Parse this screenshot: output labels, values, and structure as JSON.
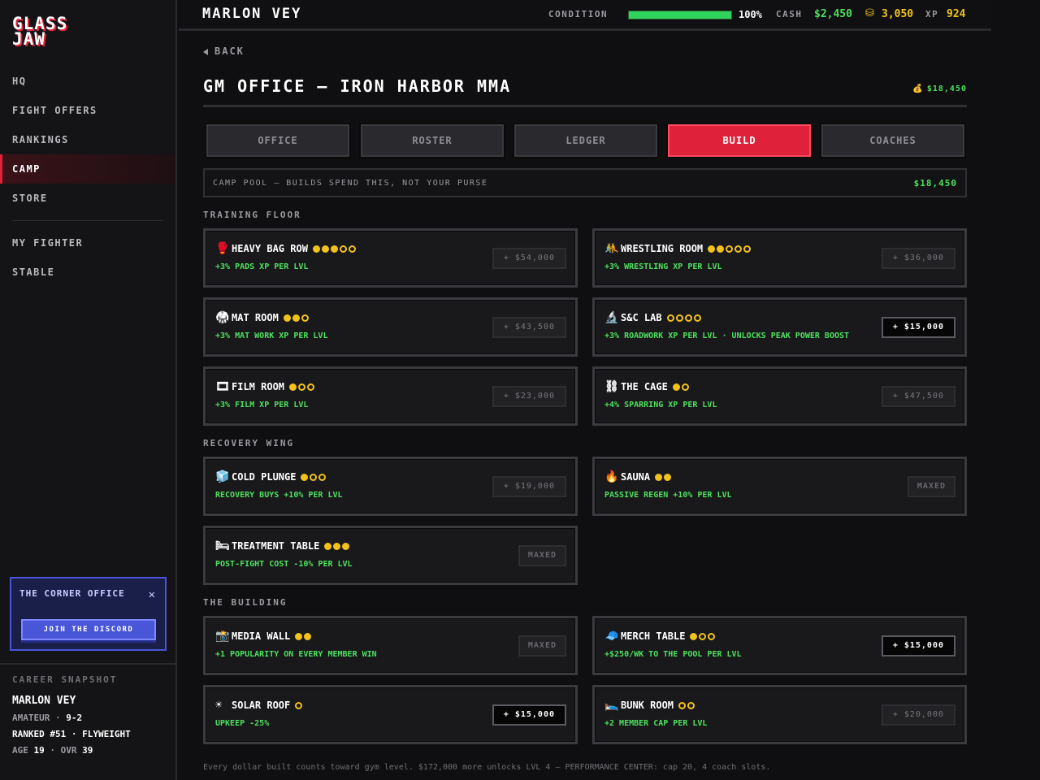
{
  "sidebar": {
    "logo_line1": "GLASS",
    "logo_line2": "JAW",
    "nav": [
      "HQ",
      "FIGHT OFFERS",
      "RANKINGS",
      "CAMP",
      "STORE"
    ],
    "nav_secondary": [
      "MY FIGHTER",
      "STABLE"
    ],
    "active": "CAMP",
    "discord": {
      "title": "THE CORNER OFFICE",
      "close": "✕",
      "button": "JOIN THE DISCORD"
    },
    "snapshot": {
      "heading": "CAREER SNAPSHOT",
      "name": "MARLON VEY",
      "level": "AMATEUR",
      "record": "9-2",
      "rank": "RANKED #51",
      "division": "FLYWEIGHT",
      "age_label": "AGE",
      "age": "19",
      "ovr_label": "OVR",
      "ovr": "39"
    }
  },
  "topbar": {
    "player": "MARLON VEY",
    "condition_label": "CONDITION",
    "condition_pct": 100,
    "condition_text": "100%",
    "cash_label": "CASH",
    "cash": "$2,450",
    "coins_icon": "coin-stack-icon",
    "coins": "3,050",
    "xp_label": "XP",
    "xp": "924",
    "colors": {
      "green": "#4de05e",
      "gold": "#f2c21b",
      "red": "#e0213a"
    }
  },
  "main": {
    "back": "BACK",
    "title": "GM OFFICE — IRON HARBOR MMA",
    "purse": "$18,450",
    "tabs": [
      "OFFICE",
      "ROSTER",
      "LEDGER",
      "BUILD",
      "COACHES"
    ],
    "active_tab": "BUILD",
    "pool_label": "CAMP POOL — BUILDS SPEND THIS, NOT YOUR PURSE",
    "pool_value": "$18,450",
    "sections": {
      "training": "TRAINING FLOOR",
      "recovery": "RECOVERY WING",
      "building": "THE BUILDING"
    },
    "cards": [
      {
        "icon": "boxing-glove-icon",
        "glyph": "🥊",
        "name": "HEAVY BAG ROW",
        "level": 3,
        "max": 5,
        "desc": "+3% PADS XP PER LVL",
        "button": "+ $54,000",
        "state": "locked"
      },
      {
        "icon": "wrestlers-icon",
        "glyph": "🤼",
        "name": "WRESTLING ROOM",
        "level": 2,
        "max": 5,
        "desc": "+3% WRESTLING XP PER LVL",
        "button": "+ $36,000",
        "state": "locked"
      },
      {
        "icon": "gi-icon",
        "glyph": "🥋",
        "name": "MAT ROOM",
        "level": 2,
        "max": 3,
        "desc": "+3% MAT WORK XP PER LVL",
        "button": "+ $43,500",
        "state": "locked"
      },
      {
        "icon": "microscope-icon",
        "glyph": "🔬",
        "name": "S&C LAB",
        "level": 0,
        "max": 4,
        "desc": "+3% ROADWORK XP PER LVL · UNLOCKS PEAK POWER BOOST",
        "button": "+ $15,000",
        "state": "afford"
      },
      {
        "icon": "film-icon",
        "glyph": "🎞",
        "name": "FILM ROOM",
        "level": 1,
        "max": 3,
        "desc": "+3% FILM XP PER LVL",
        "button": "+ $23,000",
        "state": "locked"
      },
      {
        "icon": "cage-icon",
        "glyph": "⛓",
        "name": "THE CAGE",
        "level": 1,
        "max": 2,
        "desc": "+4% SPARRING XP PER LVL",
        "button": "+ $47,500",
        "state": "locked"
      },
      {
        "icon": "ice-icon",
        "glyph": "🧊",
        "name": "COLD PLUNGE",
        "level": 1,
        "max": 3,
        "desc": "RECOVERY BUYS +10% PER LVL",
        "button": "+ $19,000",
        "state": "locked"
      },
      {
        "icon": "fire-icon",
        "glyph": "🔥",
        "name": "SAUNA",
        "level": 2,
        "max": 2,
        "desc": "PASSIVE REGEN +10% PER LVL",
        "button": "MAXED",
        "state": "maxed"
      },
      {
        "icon": "bed-icon",
        "glyph": "🛏",
        "name": "TREATMENT TABLE",
        "level": 3,
        "max": 3,
        "desc": "POST-FIGHT COST -10% PER LVL",
        "button": "MAXED",
        "state": "maxed"
      },
      {
        "icon": "camera-icon",
        "glyph": "📸",
        "name": "MEDIA WALL",
        "level": 2,
        "max": 2,
        "desc": "+1 POPULARITY ON EVERY MEMBER WIN",
        "button": "MAXED",
        "state": "maxed"
      },
      {
        "icon": "cap-icon",
        "glyph": "🧢",
        "name": "MERCH TABLE",
        "level": 1,
        "max": 3,
        "desc": "+$250/WK TO THE POOL PER LVL",
        "button": "+ $15,000",
        "state": "afford"
      },
      {
        "icon": "sun-icon",
        "glyph": "☀",
        "name": "SOLAR ROOF",
        "level": 0,
        "max": 1,
        "desc": "UPKEEP -25%",
        "button": "+ $15,000",
        "state": "afford"
      },
      {
        "icon": "bunk-bed-icon",
        "glyph": "🛌",
        "name": "BUNK ROOM",
        "level": 0,
        "max": 2,
        "desc": "+2 MEMBER CAP PER LVL",
        "button": "+ $20,000",
        "state": "locked"
      }
    ],
    "footnote": "Every dollar built counts toward gym level. $172,000 more unlocks LVL 4 — PERFORMANCE CENTER: cap 20, 4 coach slots."
  }
}
